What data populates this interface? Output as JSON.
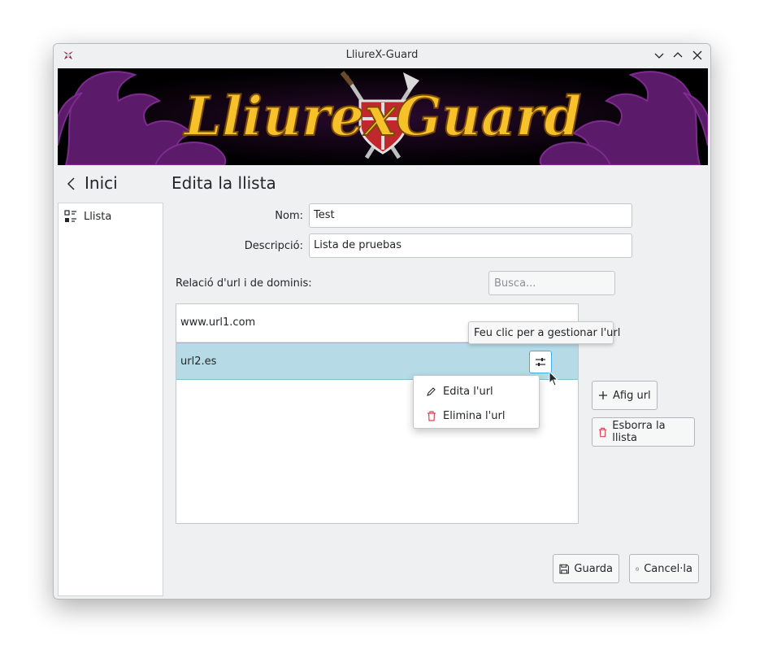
{
  "window": {
    "title": "LliureX-Guard"
  },
  "banner": {
    "logo_text": "LliurexGuard"
  },
  "nav": {
    "back_label": "Inici"
  },
  "page": {
    "title": "Edita la llista"
  },
  "sidebar": {
    "items": [
      {
        "label": "Llista",
        "icon": "list-icon"
      }
    ]
  },
  "form": {
    "name_label": "Nom:",
    "name_value": "Test",
    "description_label": "Descripció:",
    "description_value": "Lista de pruebas",
    "urls_label": "Relació d'url i de dominis:",
    "search_placeholder": "Busca..."
  },
  "url_list": {
    "rows": [
      {
        "url": "www.url1.com",
        "selected": false
      },
      {
        "url": "url2.es",
        "selected": true
      }
    ]
  },
  "tooltip": {
    "text": "Feu clic per a gestionar l'url"
  },
  "context_menu": {
    "items": [
      {
        "label": "Edita l'url",
        "icon": "pencil-icon"
      },
      {
        "label": "Elimina l'url",
        "icon": "trash-icon"
      }
    ]
  },
  "actions": {
    "add_url": "Afig url",
    "delete_list": "Esborra la llista",
    "save": "Guarda",
    "cancel": "Cancel·la"
  },
  "colors": {
    "window_bg": "#eff0f1",
    "selection": "#b6dbe6",
    "accent": "#3daee9",
    "danger": "#da4453",
    "logo_yellow": "#f6c12a",
    "dragon_purple": "#5c1a6b"
  }
}
